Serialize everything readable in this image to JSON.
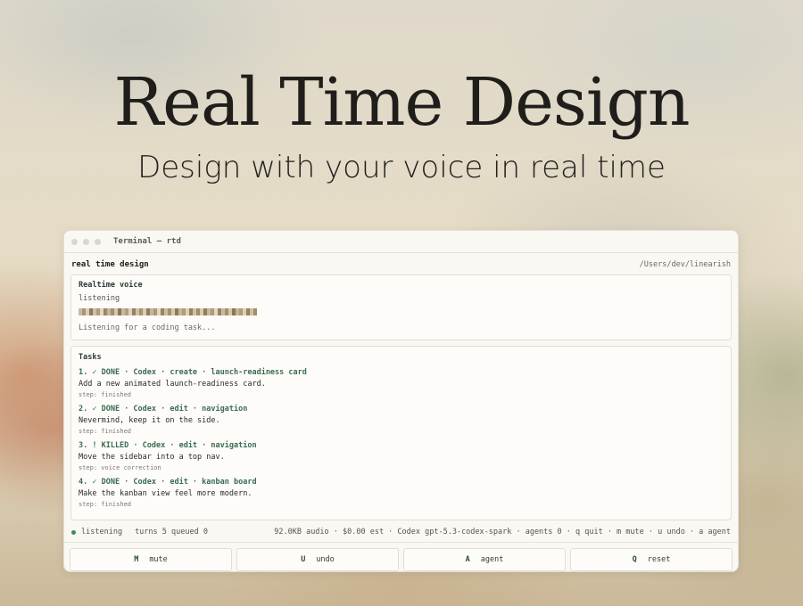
{
  "hero": {
    "title": "Real Time Design",
    "subtitle": "Design with your voice in real time"
  },
  "window": {
    "title": "Terminal — rtd"
  },
  "app": {
    "name": "real time design",
    "path": "/Users/dev/linearish"
  },
  "voice": {
    "title": "Realtime voice",
    "status": "listening",
    "hint": "Listening for a coding task...",
    "waveform_colors": [
      "#c9bca6",
      "#a89474",
      "#d8cdb8",
      "#8f7a59",
      "#cbbfa8",
      "#b09d7d",
      "#e0d6c4",
      "#9c8664",
      "#c4b59b",
      "#a58f6c",
      "#d5c8b1",
      "#8c7655",
      "#c8b99f",
      "#b3a07f",
      "#ddd2bf",
      "#98815f",
      "#cdbfa5",
      "#a99470",
      "#d9cdb6",
      "#927c5a",
      "#c6b79c",
      "#ad9876",
      "#e2d8c6",
      "#9a8461",
      "#cbbca1",
      "#a7916e",
      "#d6c9b2",
      "#8e7857",
      "#c5b69b",
      "#b19c7a",
      "#dcd0bc",
      "#96805e",
      "#cfc1a7",
      "#a48e6b",
      "#d7cab3",
      "#917b59",
      "#c7b89e",
      "#af9a78",
      "#e1d7c5",
      "#99835f",
      "#cabba0",
      "#a6906d",
      "#d4c7b0",
      "#8d7756",
      "#c3b499",
      "#b29d7b",
      "#dbcfbb",
      "#97815f",
      "#cec0a6",
      "#a38d6a"
    ]
  },
  "tasks": {
    "title": "Tasks",
    "items": [
      {
        "head": "1. ✓ DONE · Codex · create · launch-readiness card",
        "desc": "Add a new animated launch-readiness card.",
        "step": "step: finished"
      },
      {
        "head": "2. ✓ DONE · Codex · edit · navigation",
        "desc": "Nevermind, keep it on the side.",
        "step": "step: finished"
      },
      {
        "head": "3. ! KILLED · Codex · edit · navigation",
        "desc": "Move the sidebar into a top nav.",
        "step": "step: voice correction"
      },
      {
        "head": "4. ✓ DONE · Codex · edit · kanban board",
        "desc": "Make the kanban view feel more modern.",
        "step": "step: finished"
      }
    ]
  },
  "status": {
    "state": "listening",
    "counts": "turns 5 queued 0",
    "right": "92.0KB audio · $0.00 est · Codex gpt-5.3-codex-spark · agents 0 · q quit · m mute · u undo · a agent"
  },
  "keys": [
    {
      "key": "M",
      "label": "mute"
    },
    {
      "key": "U",
      "label": "undo"
    },
    {
      "key": "A",
      "label": "agent"
    },
    {
      "key": "Q",
      "label": "reset"
    }
  ],
  "colors": {
    "accent": "#3b6b54",
    "status_dot": "#3f8a5e"
  }
}
